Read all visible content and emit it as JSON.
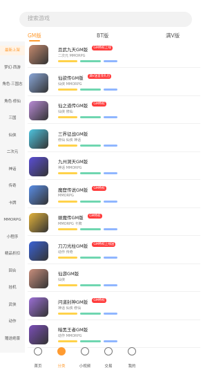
{
  "search": {
    "placeholder": "搜索游戏"
  },
  "tabs": [
    {
      "label": "GM版",
      "active": true
    },
    {
      "label": "BT版",
      "active": false
    },
    {
      "label": "满V版",
      "active": false
    }
  ],
  "sidebar": {
    "items": [
      {
        "label": "最新上架",
        "active": true
      },
      {
        "label": "梦幻·西游",
        "active": false
      },
      {
        "label": "角色·三国志",
        "active": false
      },
      {
        "label": "角色·修仙",
        "active": false
      },
      {
        "label": "三国",
        "active": false
      },
      {
        "label": "仙侠",
        "active": false
      },
      {
        "label": "二次元",
        "active": false
      },
      {
        "label": "神话",
        "active": false
      },
      {
        "label": "传奇",
        "active": false
      },
      {
        "label": "卡牌",
        "active": false
      },
      {
        "label": "MMORPG",
        "active": false
      },
      {
        "label": "小程序",
        "active": false
      },
      {
        "label": "精品折扣",
        "active": false
      },
      {
        "label": "回合",
        "active": false
      },
      {
        "label": "挂机",
        "active": false
      },
      {
        "label": "武侠",
        "active": false
      },
      {
        "label": "动作",
        "active": false
      },
      {
        "label": "赠送绝版",
        "active": false
      }
    ]
  },
  "games": [
    {
      "name": "且武九天GM版",
      "tag": "GM特权上线",
      "meta": "二次元 MMORPG",
      "thumb_color": "#c58a6e"
    },
    {
      "name": "仙欲传GM版",
      "tag": "满V送首充礼包",
      "meta": "仙侠 MMORPG",
      "thumb_color": "#8aa7d8"
    },
    {
      "name": "仙之道传GM版",
      "tag": "GM特权",
      "meta": "仙侠 修仙",
      "thumb_color": "#b98bd6"
    },
    {
      "name": "三界征战GM版",
      "tag": "",
      "meta": "修仙 仙侠 神话",
      "thumb_color": "#4fc5e0"
    },
    {
      "name": "九州洞天GM版",
      "tag": "",
      "meta": "神话 MMORPG",
      "thumb_color": "#5b4fd6"
    },
    {
      "name": "魔窟传说GM版",
      "tag": "GM特权",
      "meta": "MMORPG",
      "thumb_color": "#5a8ee6"
    },
    {
      "name": "娱魔传GM版",
      "tag": "GM特权",
      "meta": "MMORPG 卡牌",
      "thumb_color": "#e2b33c"
    },
    {
      "name": "刀刀光柱GM版",
      "tag": "GM特权上线送",
      "meta": "动作 传奇",
      "thumb_color": "#3b63d6"
    },
    {
      "name": "仙游GM版",
      "tag": "",
      "meta": "仙侠",
      "thumb_color": "#c98f7d"
    },
    {
      "name": "问道封神GM版",
      "tag": "GM特权",
      "meta": "神话 仙侠 修仙",
      "thumb_color": "#9c6fd6"
    },
    {
      "name": "暗黑王者GM版",
      "tag": "",
      "meta": "动作 MMORPG",
      "thumb_color": "#7b4fb8"
    }
  ],
  "bottom_nav": [
    {
      "label": "首页",
      "active": false
    },
    {
      "label": "分类",
      "active": true
    },
    {
      "label": "小视频",
      "active": false
    },
    {
      "label": "交易",
      "active": false
    },
    {
      "label": "我的",
      "active": false
    }
  ],
  "colors": {
    "accent": "#ff9b30",
    "tag": "#ff3b3b",
    "bar_yellow": "#ffd24a",
    "bar_green": "#6fd6b0",
    "bar_blue": "#8fb6ff"
  }
}
